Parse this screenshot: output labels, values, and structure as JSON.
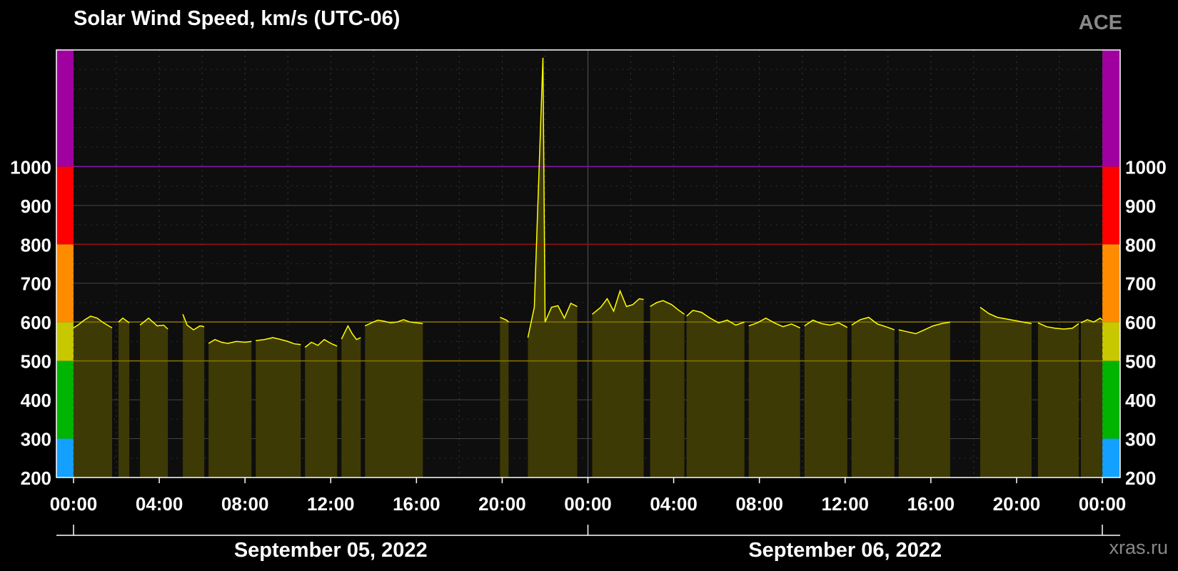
{
  "chart_title": "Solar Wind Speed, km/s (UTC-06)",
  "source_label": "ACE",
  "credit": "xras.ru",
  "chart_data": {
    "type": "area",
    "title": "Solar Wind Speed, km/s (UTC-06)",
    "xlabel": "",
    "ylabel": "",
    "x_unit": "hours since Sep 05 2022 00:00 (UTC-06)",
    "xlim": [
      0,
      48
    ],
    "ylim": [
      200,
      1300
    ],
    "y_ticks": [
      200,
      300,
      400,
      500,
      600,
      700,
      800,
      900,
      1000
    ],
    "x_tick_labels": [
      "00:00",
      "04:00",
      "08:00",
      "12:00",
      "16:00",
      "20:00",
      "00:00",
      "04:00",
      "08:00",
      "12:00",
      "16:00",
      "20:00",
      "00:00"
    ],
    "date_labels": [
      "September 05, 2022",
      "September 06, 2022"
    ],
    "grid": true,
    "thresholds": [
      {
        "value": 500,
        "color": "#8a7400"
      },
      {
        "value": 600,
        "color": "#8a7400"
      },
      {
        "value": 800,
        "color": "#9a1010"
      },
      {
        "value": 1000,
        "color": "#8a14b0"
      }
    ],
    "scale_bands": [
      {
        "from": 200,
        "to": 300,
        "color": "#14a0ff"
      },
      {
        "from": 300,
        "to": 500,
        "color": "#00b400"
      },
      {
        "from": 500,
        "to": 600,
        "color": "#c8c800"
      },
      {
        "from": 600,
        "to": 800,
        "color": "#ff8c00"
      },
      {
        "from": 800,
        "to": 1000,
        "color": "#ff0000"
      },
      {
        "from": 1000,
        "to": 1300,
        "color": "#a000a0"
      }
    ],
    "line_color": "#ffff00",
    "fill_color": "#3e3a06",
    "series": [
      {
        "segment": [
          [
            0,
            585
          ],
          [
            0.2,
            592
          ],
          [
            0.5,
            605
          ],
          [
            0.8,
            615
          ],
          [
            1.1,
            610
          ],
          [
            1.4,
            598
          ],
          [
            1.8,
            585
          ]
        ]
      },
      {
        "segment": [
          [
            2.1,
            600
          ],
          [
            2.3,
            610
          ],
          [
            2.6,
            598
          ]
        ]
      },
      {
        "segment": [
          [
            3.1,
            592
          ],
          [
            3.5,
            610
          ],
          [
            3.9,
            590
          ],
          [
            4.2,
            592
          ],
          [
            4.4,
            582
          ]
        ]
      },
      {
        "segment": [
          [
            5.1,
            620
          ],
          [
            5.3,
            592
          ],
          [
            5.6,
            580
          ],
          [
            5.9,
            590
          ],
          [
            6.1,
            588
          ]
        ]
      },
      {
        "segment": [
          [
            6.3,
            545
          ],
          [
            6.6,
            555
          ],
          [
            6.9,
            548
          ],
          [
            7.2,
            545
          ],
          [
            7.6,
            550
          ],
          [
            8.0,
            548
          ],
          [
            8.3,
            550
          ]
        ]
      },
      {
        "segment": [
          [
            8.5,
            552
          ],
          [
            8.9,
            555
          ],
          [
            9.3,
            560
          ],
          [
            9.6,
            556
          ],
          [
            10.0,
            550
          ],
          [
            10.3,
            544
          ],
          [
            10.6,
            542
          ]
        ]
      },
      {
        "segment": [
          [
            10.8,
            535
          ],
          [
            11.1,
            548
          ],
          [
            11.4,
            540
          ],
          [
            11.7,
            555
          ],
          [
            12.0,
            545
          ],
          [
            12.3,
            538
          ]
        ]
      },
      {
        "segment": [
          [
            12.5,
            556
          ],
          [
            12.8,
            590
          ],
          [
            13.0,
            570
          ],
          [
            13.2,
            555
          ],
          [
            13.4,
            560
          ]
        ]
      },
      {
        "segment": [
          [
            13.6,
            590
          ],
          [
            13.9,
            598
          ],
          [
            14.2,
            605
          ],
          [
            14.5,
            602
          ],
          [
            14.8,
            598
          ],
          [
            15.1,
            600
          ],
          [
            15.4,
            606
          ],
          [
            15.7,
            600
          ],
          [
            16.0,
            598
          ],
          [
            16.3,
            596
          ]
        ]
      },
      {
        "segment": [
          [
            19.9,
            612
          ],
          [
            20.2,
            605
          ],
          [
            20.3,
            600
          ]
        ]
      },
      {
        "segment": [
          [
            21.2,
            560
          ],
          [
            21.5,
            638
          ],
          [
            21.9,
            1280
          ],
          [
            22.0,
            600
          ],
          [
            22.3,
            638
          ],
          [
            22.6,
            642
          ],
          [
            22.9,
            610
          ],
          [
            23.2,
            648
          ],
          [
            23.5,
            640
          ]
        ]
      },
      {
        "segment": [
          [
            24.2,
            620
          ],
          [
            24.6,
            638
          ],
          [
            24.9,
            660
          ],
          [
            25.2,
            628
          ],
          [
            25.5,
            680
          ],
          [
            25.8,
            640
          ],
          [
            26.1,
            645
          ],
          [
            26.4,
            660
          ],
          [
            26.6,
            658
          ]
        ]
      },
      {
        "segment": [
          [
            26.9,
            640
          ],
          [
            27.2,
            650
          ],
          [
            27.5,
            655
          ],
          [
            27.9,
            645
          ],
          [
            28.2,
            632
          ],
          [
            28.5,
            620
          ]
        ]
      },
      {
        "segment": [
          [
            28.6,
            615
          ],
          [
            28.9,
            630
          ],
          [
            29.3,
            625
          ],
          [
            29.7,
            610
          ],
          [
            30.1,
            598
          ],
          [
            30.5,
            605
          ],
          [
            30.9,
            592
          ],
          [
            31.3,
            600
          ]
        ]
      },
      {
        "segment": [
          [
            31.5,
            590
          ],
          [
            31.9,
            598
          ],
          [
            32.3,
            610
          ],
          [
            32.7,
            598
          ],
          [
            33.1,
            588
          ],
          [
            33.5,
            595
          ],
          [
            33.9,
            585
          ]
        ]
      },
      {
        "segment": [
          [
            34.1,
            590
          ],
          [
            34.5,
            605
          ],
          [
            34.9,
            596
          ],
          [
            35.3,
            592
          ],
          [
            35.7,
            598
          ],
          [
            36.1,
            586
          ]
        ]
      },
      {
        "segment": [
          [
            36.3,
            592
          ],
          [
            36.7,
            606
          ],
          [
            37.1,
            612
          ],
          [
            37.5,
            595
          ],
          [
            37.9,
            588
          ],
          [
            38.3,
            580
          ]
        ]
      },
      {
        "segment": [
          [
            38.5,
            580
          ],
          [
            38.9,
            575
          ],
          [
            39.3,
            570
          ],
          [
            39.7,
            580
          ],
          [
            40.1,
            590
          ],
          [
            40.5,
            596
          ],
          [
            40.9,
            600
          ]
        ]
      },
      {
        "segment": [
          [
            42.3,
            638
          ],
          [
            42.7,
            622
          ],
          [
            43.1,
            612
          ],
          [
            43.5,
            608
          ],
          [
            43.9,
            604
          ],
          [
            44.3,
            600
          ],
          [
            44.7,
            596
          ]
        ]
      },
      {
        "segment": [
          [
            45.0,
            598
          ],
          [
            45.4,
            588
          ],
          [
            45.8,
            584
          ],
          [
            46.2,
            582
          ],
          [
            46.6,
            584
          ],
          [
            46.9,
            596
          ]
        ]
      },
      {
        "segment": [
          [
            47.0,
            598
          ],
          [
            47.3,
            606
          ],
          [
            47.6,
            600
          ],
          [
            47.9,
            610
          ],
          [
            48.0,
            605
          ]
        ]
      }
    ]
  }
}
